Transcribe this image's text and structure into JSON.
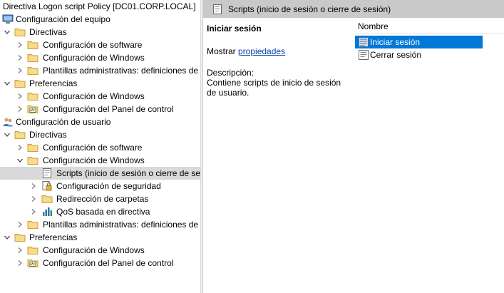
{
  "tree": {
    "root_label": "Directiva Logon script Policy [DC01.CORP.LOCAL]",
    "items": [
      {
        "label": "Configuración del equipo",
        "icon": "computer-icon"
      },
      {
        "label": "Directivas",
        "icon": "folder-icon"
      },
      {
        "label": "Configuración de software",
        "icon": "folder-icon"
      },
      {
        "label": "Configuración de Windows",
        "icon": "folder-icon"
      },
      {
        "label": "Plantillas administrativas: definiciones de",
        "icon": "folder-icon"
      },
      {
        "label": "Preferencias",
        "icon": "folder-icon"
      },
      {
        "label": "Configuración de Windows",
        "icon": "folder-icon"
      },
      {
        "label": "Configuración del Panel de control",
        "icon": "control-panel-folder-icon"
      },
      {
        "label": "Configuración de usuario",
        "icon": "users-icon"
      },
      {
        "label": "Directivas",
        "icon": "folder-icon"
      },
      {
        "label": "Configuración de software",
        "icon": "folder-icon"
      },
      {
        "label": "Configuración de Windows",
        "icon": "folder-icon"
      },
      {
        "label": "Scripts (inicio de sesión o cierre de ses",
        "icon": "script-icon"
      },
      {
        "label": "Configuración de seguridad",
        "icon": "security-icon"
      },
      {
        "label": "Redirección de carpetas",
        "icon": "folder-icon"
      },
      {
        "label": "QoS basada en directiva",
        "icon": "qos-chart-icon"
      },
      {
        "label": "Plantillas administrativas: definiciones de",
        "icon": "folder-icon"
      },
      {
        "label": "Preferencias",
        "icon": "folder-icon"
      },
      {
        "label": "Configuración de Windows",
        "icon": "folder-icon"
      },
      {
        "label": "Configuración del Panel de control",
        "icon": "control-panel-folder-icon"
      }
    ]
  },
  "right": {
    "header_title": "Scripts (inicio de sesión o cierre de sesión)",
    "detail": {
      "title": "Iniciar sesión",
      "show_prefix": "Mostrar ",
      "show_link": "propiedades",
      "description_label": "Descripción:",
      "description_text": "Contiene scripts de inicio de sesión de usuario."
    },
    "list": {
      "column_header": "Nombre",
      "items": [
        {
          "label": "Iniciar sesión",
          "selected": true
        },
        {
          "label": "Cerrar sesión",
          "selected": false
        }
      ]
    }
  },
  "colors": {
    "selection_blue": "#0078d7",
    "tree_selected": "#d9d9d9",
    "header_gray": "#c9c9c9",
    "folder_yellow": "#e8c25b",
    "link_blue": "#0645ad"
  }
}
